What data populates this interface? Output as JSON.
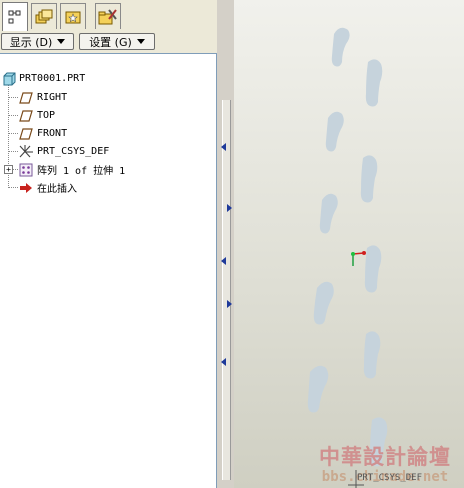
{
  "tabs": [
    {
      "name": "model-tree-tab",
      "icon": "model-tree-icon"
    },
    {
      "name": "folder-browser-tab",
      "icon": "layers-icon"
    },
    {
      "name": "favorites-tab",
      "icon": "favorites-icon"
    },
    {
      "name": "tools-tab",
      "icon": "folder-tools-icon"
    }
  ],
  "toolbar": {
    "display_label": "显示 (D)",
    "settings_label": "设置 (G)"
  },
  "tree": {
    "root": "PRT0001.PRT",
    "items": [
      {
        "label": "RIGHT",
        "icon": "datum-plane-icon"
      },
      {
        "label": "TOP",
        "icon": "datum-plane-icon"
      },
      {
        "label": "FRONT",
        "icon": "datum-plane-icon"
      },
      {
        "label": "PRT_CSYS_DEF",
        "icon": "csys-icon"
      },
      {
        "label": "阵列 1 of 拉伸 1",
        "icon": "pattern-icon"
      },
      {
        "label": "在此插入",
        "icon": "insert-here-arrow-icon"
      }
    ]
  },
  "watermark": {
    "title": "中華設計論壇",
    "url": "bbs.chinade.net"
  },
  "graphics": {
    "csys_label": "PRT_CSYS_DEF",
    "shape_color": "#c9d4dc"
  }
}
